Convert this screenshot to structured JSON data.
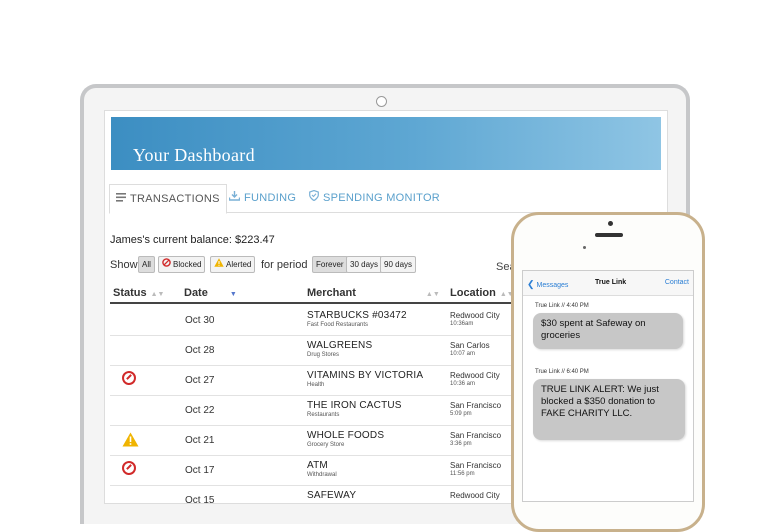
{
  "dashboard": {
    "title": "Your Dashboard",
    "tabs": [
      {
        "label": "TRANSACTIONS",
        "icon": "list-icon",
        "active": true
      },
      {
        "label": "FUNDING",
        "icon": "download-icon",
        "active": false
      },
      {
        "label": "SPENDING MONITOR",
        "icon": "shield-icon",
        "active": false
      }
    ],
    "balance_text": "James's current balance: $223.47",
    "filter": {
      "show_label": "Show",
      "all_label": "All",
      "blocked_label": "Blocked",
      "alerted_label": "Alerted",
      "period_label": "for period",
      "period_options": [
        "Forever",
        "30 days",
        "90 days"
      ],
      "selected_period": "Forever"
    },
    "search_label": "Sear",
    "columns": [
      "Status",
      "Date",
      "Merchant",
      "Location"
    ],
    "rows": [
      {
        "status": "",
        "date": "Oct 30",
        "merchant": "STARBUCKS #03472",
        "category": "Fast Food Restaurants",
        "city": "Redwood City",
        "time": "10:36am"
      },
      {
        "status": "",
        "date": "Oct 28",
        "merchant": "WALGREENS",
        "category": "Drug Stores",
        "city": "San Carlos",
        "time": "10:07 am"
      },
      {
        "status": "blocked",
        "date": "Oct 27",
        "merchant": "VITAMINS BY VICTORIA",
        "category": "Health",
        "city": "Redwood City",
        "time": "10:36 am"
      },
      {
        "status": "",
        "date": "Oct 22",
        "merchant": "THE IRON CACTUS",
        "category": "Restaurants",
        "city": "San Francisco",
        "time": "5:09 pm"
      },
      {
        "status": "alerted",
        "date": "Oct 21",
        "merchant": "WHOLE FOODS",
        "category": "Grocery Store",
        "city": "San Francisco",
        "time": "3:36 pm"
      },
      {
        "status": "blocked",
        "date": "Oct 17",
        "merchant": "ATM",
        "category": "Withdrawal",
        "city": "San Francisco",
        "time": "11:56 pm"
      },
      {
        "status": "",
        "date": "Oct 15",
        "merchant": "SAFEWAY",
        "category": "",
        "city": "Redwood City",
        "time": ""
      }
    ]
  },
  "phone": {
    "back_label": "Messages",
    "title": "True Link",
    "contact_label": "Contact",
    "messages": [
      {
        "meta": "True Link  //  4:40 PM",
        "text": "$30 spent at Safeway on groceries"
      },
      {
        "meta": "True Link  //  6:40 PM",
        "text": "TRUE LINK ALERT: We just blocked a $350 donation to FAKE CHARITY LLC."
      }
    ]
  },
  "colors": {
    "banner": "#4a9acb",
    "tab_link": "#5aa0cc",
    "blocked": "#d12a2a",
    "alert": "#f0b400",
    "phone_frame": "#c8b18c",
    "bubble": "#c7c7c7"
  }
}
